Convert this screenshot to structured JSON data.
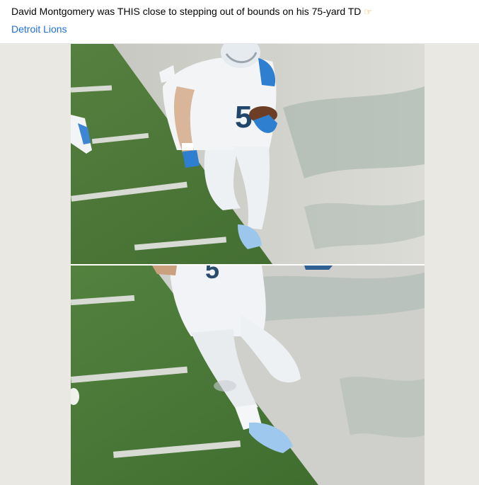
{
  "post": {
    "caption": "David Montgomery was THIS close to stepping out of bounds on his 75-yard TD",
    "caption_emoji": "pointing-hand-emoji",
    "page_link": "Detroit Lions"
  },
  "media": {
    "jersey_number": "5",
    "colors": {
      "turf": "#4f7a3a",
      "sideline": "#c9c9c4",
      "jersey": "#f4f6f8",
      "team_blue": "#2f7fd0",
      "background": "#e9e8e3"
    }
  }
}
